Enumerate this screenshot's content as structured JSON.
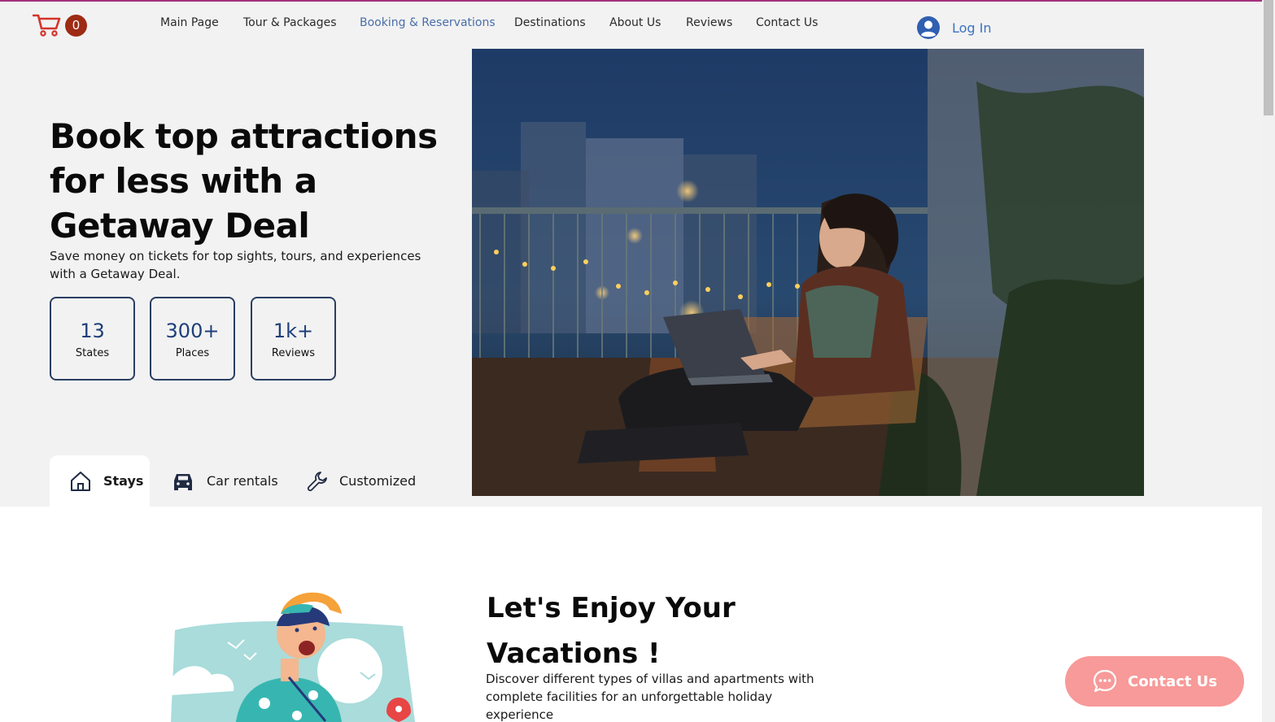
{
  "header": {
    "cart_count": "0",
    "nav": [
      {
        "label": "Main Page",
        "active": false
      },
      {
        "label": "Tour & Packages",
        "active": false
      },
      {
        "label": "Booking & Reservations",
        "active": true
      },
      {
        "label": "Destinations",
        "active": false
      },
      {
        "label": "About Us",
        "active": false
      },
      {
        "label": "Reviews",
        "active": false
      },
      {
        "label": "Contact Us",
        "active": false
      }
    ],
    "login_label": "Log In"
  },
  "hero": {
    "title_lines": [
      "Book top attractions",
      "for less with a",
      "Getaway Deal"
    ],
    "subtitle": "Save money on tickets for top sights, tours, and experiences with a Getaway Deal.",
    "stats": [
      {
        "value": "13",
        "label": "States"
      },
      {
        "value": "300+",
        "label": "Places"
      },
      {
        "value": "1k+",
        "label": "Reviews"
      }
    ],
    "tabs": [
      {
        "label": "Stays",
        "icon": "home-icon",
        "active": true
      },
      {
        "label": "Car rentals",
        "icon": "car-icon",
        "active": false
      },
      {
        "label": "Customized",
        "icon": "wrench-icon",
        "active": false
      }
    ]
  },
  "section": {
    "title_lines": [
      "Let's Enjoy Your",
      "Vacations !"
    ],
    "text": "Discover different types of villas and apartments with complete facilities for an unforgettable holiday experience"
  },
  "contact_button": {
    "label": "Contact Us",
    "icon": "chat-icon"
  },
  "colors": {
    "accent": "#4a6ea9",
    "stat_border": "#2a3f62",
    "cart_red": "#d3352a",
    "contact_pink": "#f79a99",
    "top_line": "#a3327d"
  }
}
